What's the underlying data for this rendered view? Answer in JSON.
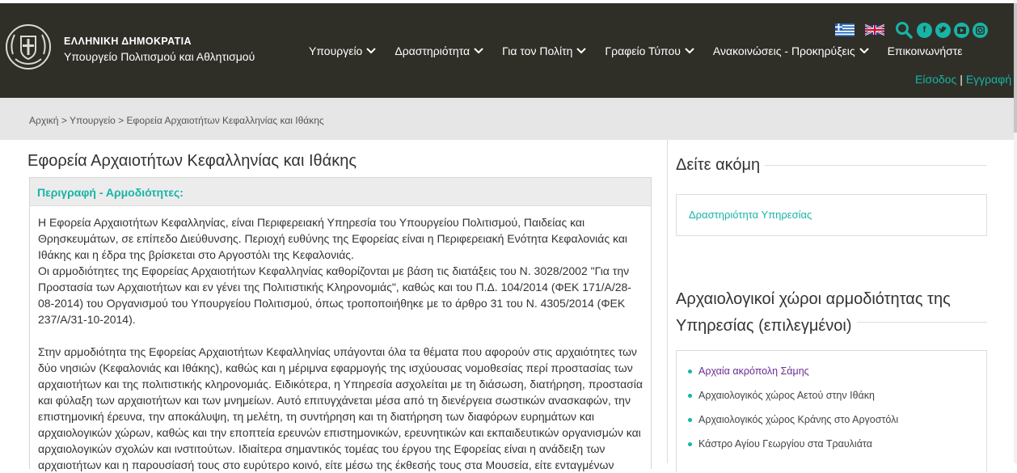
{
  "header": {
    "brand_line1": "ΕΛΛΗΝΙΚΗ ΔΗΜΟΚΡΑΤΙΑ",
    "brand_line2": "Υπουργείο Πολιτισμού και Αθλητισμού",
    "nav": [
      {
        "label": "Υπουργείο",
        "has_dropdown": true
      },
      {
        "label": "Δραστηριότητα",
        "has_dropdown": true
      },
      {
        "label": "Για τον Πολίτη",
        "has_dropdown": true
      },
      {
        "label": "Γραφείο Τύπου",
        "has_dropdown": true
      },
      {
        "label": "Ανακοινώσεις - Προκηρύξεις",
        "has_dropdown": true
      },
      {
        "label": "Επικοινωνήστε",
        "has_dropdown": false
      }
    ],
    "icons": [
      "greek-flag-icon",
      "uk-flag-icon",
      "search-icon",
      "facebook-icon",
      "twitter-icon",
      "youtube-icon",
      "instagram-icon"
    ],
    "login_label": "Είσοδος",
    "separator": "|",
    "register_label": "Εγγραφή"
  },
  "breadcrumb": {
    "home": "Αρχική",
    "sep": ">",
    "ministry": "Υπουργείο",
    "current": "Εφορεία Αρχαιοτήτων Κεφαλληνίας και Ιθάκης"
  },
  "main": {
    "title": "Εφορεία Αρχαιοτήτων Κεφαλληνίας και Ιθάκης",
    "section_heading": "Περιγραφή - Αρμοδιότητες:",
    "paragraphs": [
      "Η Εφορεία Αρχαιοτήτων Κεφαλληνίας, είναι Περιφερειακή Υπηρεσία του Υπουργείου Πολιτισμού, Παιδείας και Θρησκευμάτων, σε επίπεδο Διεύθυνσης. Περιοχή ευθύνης της Εφορείας είναι η Περιφερειακή Ενότητα Κεφαλονιάς και Ιθάκης και η έδρα της βρίσκεται στο Αργοστόλι της Κεφαλονιάς.",
      "Οι αρμοδιότητες της Εφορείας Αρχαιοτήτων Κεφαλληνίας καθορίζονται με βάση τις διατάξεις του Ν. 3028/2002 \"Για την Προστασία των Αρχαιοτήτων και εν γένει της Πολιτιστικής Κληρονομιάς\", καθώς και του Π.Δ. 104/2014 (ΦΕΚ 171/Α/28-08-2014) του Οργανισμού του Υπουργείου Πολιτισμού, όπως τροποποιήθηκε με το άρθρο 31 του Ν. 4305/2014 (ΦΕΚ 237/Α/31-10-2014).",
      "Στην αρμοδιότητα της Εφορείας Αρχαιοτήτων Κεφαλληνίας υπάγονται όλα τα θέματα που αφορούν στις αρχαιότητες των δύο νησιών (Κεφαλονιάς και Ιθάκης), καθώς και η μέριμνα εφαρμογής της ισχύουσας νομοθεσίας περί προστασίας των αρχαιοτήτων και της πολιτιστικής κληρονομιάς. Ειδικότερα, η Υπηρεσία ασχολείται με τη διάσωση, διατήρηση, προστασία και φύλαξη των αρχαιοτήτων και των μνημείων. Αυτό επιτυγχάνεται μέσα από τη διενέργεια σωστικών ανασκαφών, την επιστημονική έρευνα, την αποκάλυψη, τη μελέτη, τη συντήρηση και τη διατήρηση των διαφόρων ευρημάτων και αρχαιολογικών χώρων, καθώς και την εποπτεία ερευνών επιστημονικών, ερευνητικών και εκπαιδευτικών οργανισμών και αρχαιολογικών σχολών και ινστιτούτων. Ιδιαίτερα σημαντικός τομέας του έργου της Εφορείας είναι η ανάδειξη των αρχαιοτήτων και η παρουσίασή τους στο ευρύτερο κοινό, είτε μέσω της έκθεσής τους στα Μουσεία, είτε ενταγμένων"
    ]
  },
  "sidebar": {
    "see_more_title": "Δείτε ακόμη",
    "see_more_link": "Δραστηριότητα Υπηρεσίας",
    "sites_title_line1": "Αρχαιολογικοί χώροι αρμοδιότητας της",
    "sites_title_line2": "Υπηρεσίας (επιλεγμένοι)",
    "sites": [
      "Αρχαία ακρόπολη Σάμης",
      "Αρχαιολογικός χώρος Αετού στην Ιθάκη",
      "Αρχαιολογικός χώρος Κράνης στο Αργοστόλι",
      "Κάστρο Αγίου Γεωργίου στα Τραυλιάτα"
    ]
  },
  "colors": {
    "header_bg": "#2f2f28",
    "accent": "#18b4a6",
    "visited_link": "#6b2c91",
    "breadcrumb_bg": "#e6e6e6"
  }
}
